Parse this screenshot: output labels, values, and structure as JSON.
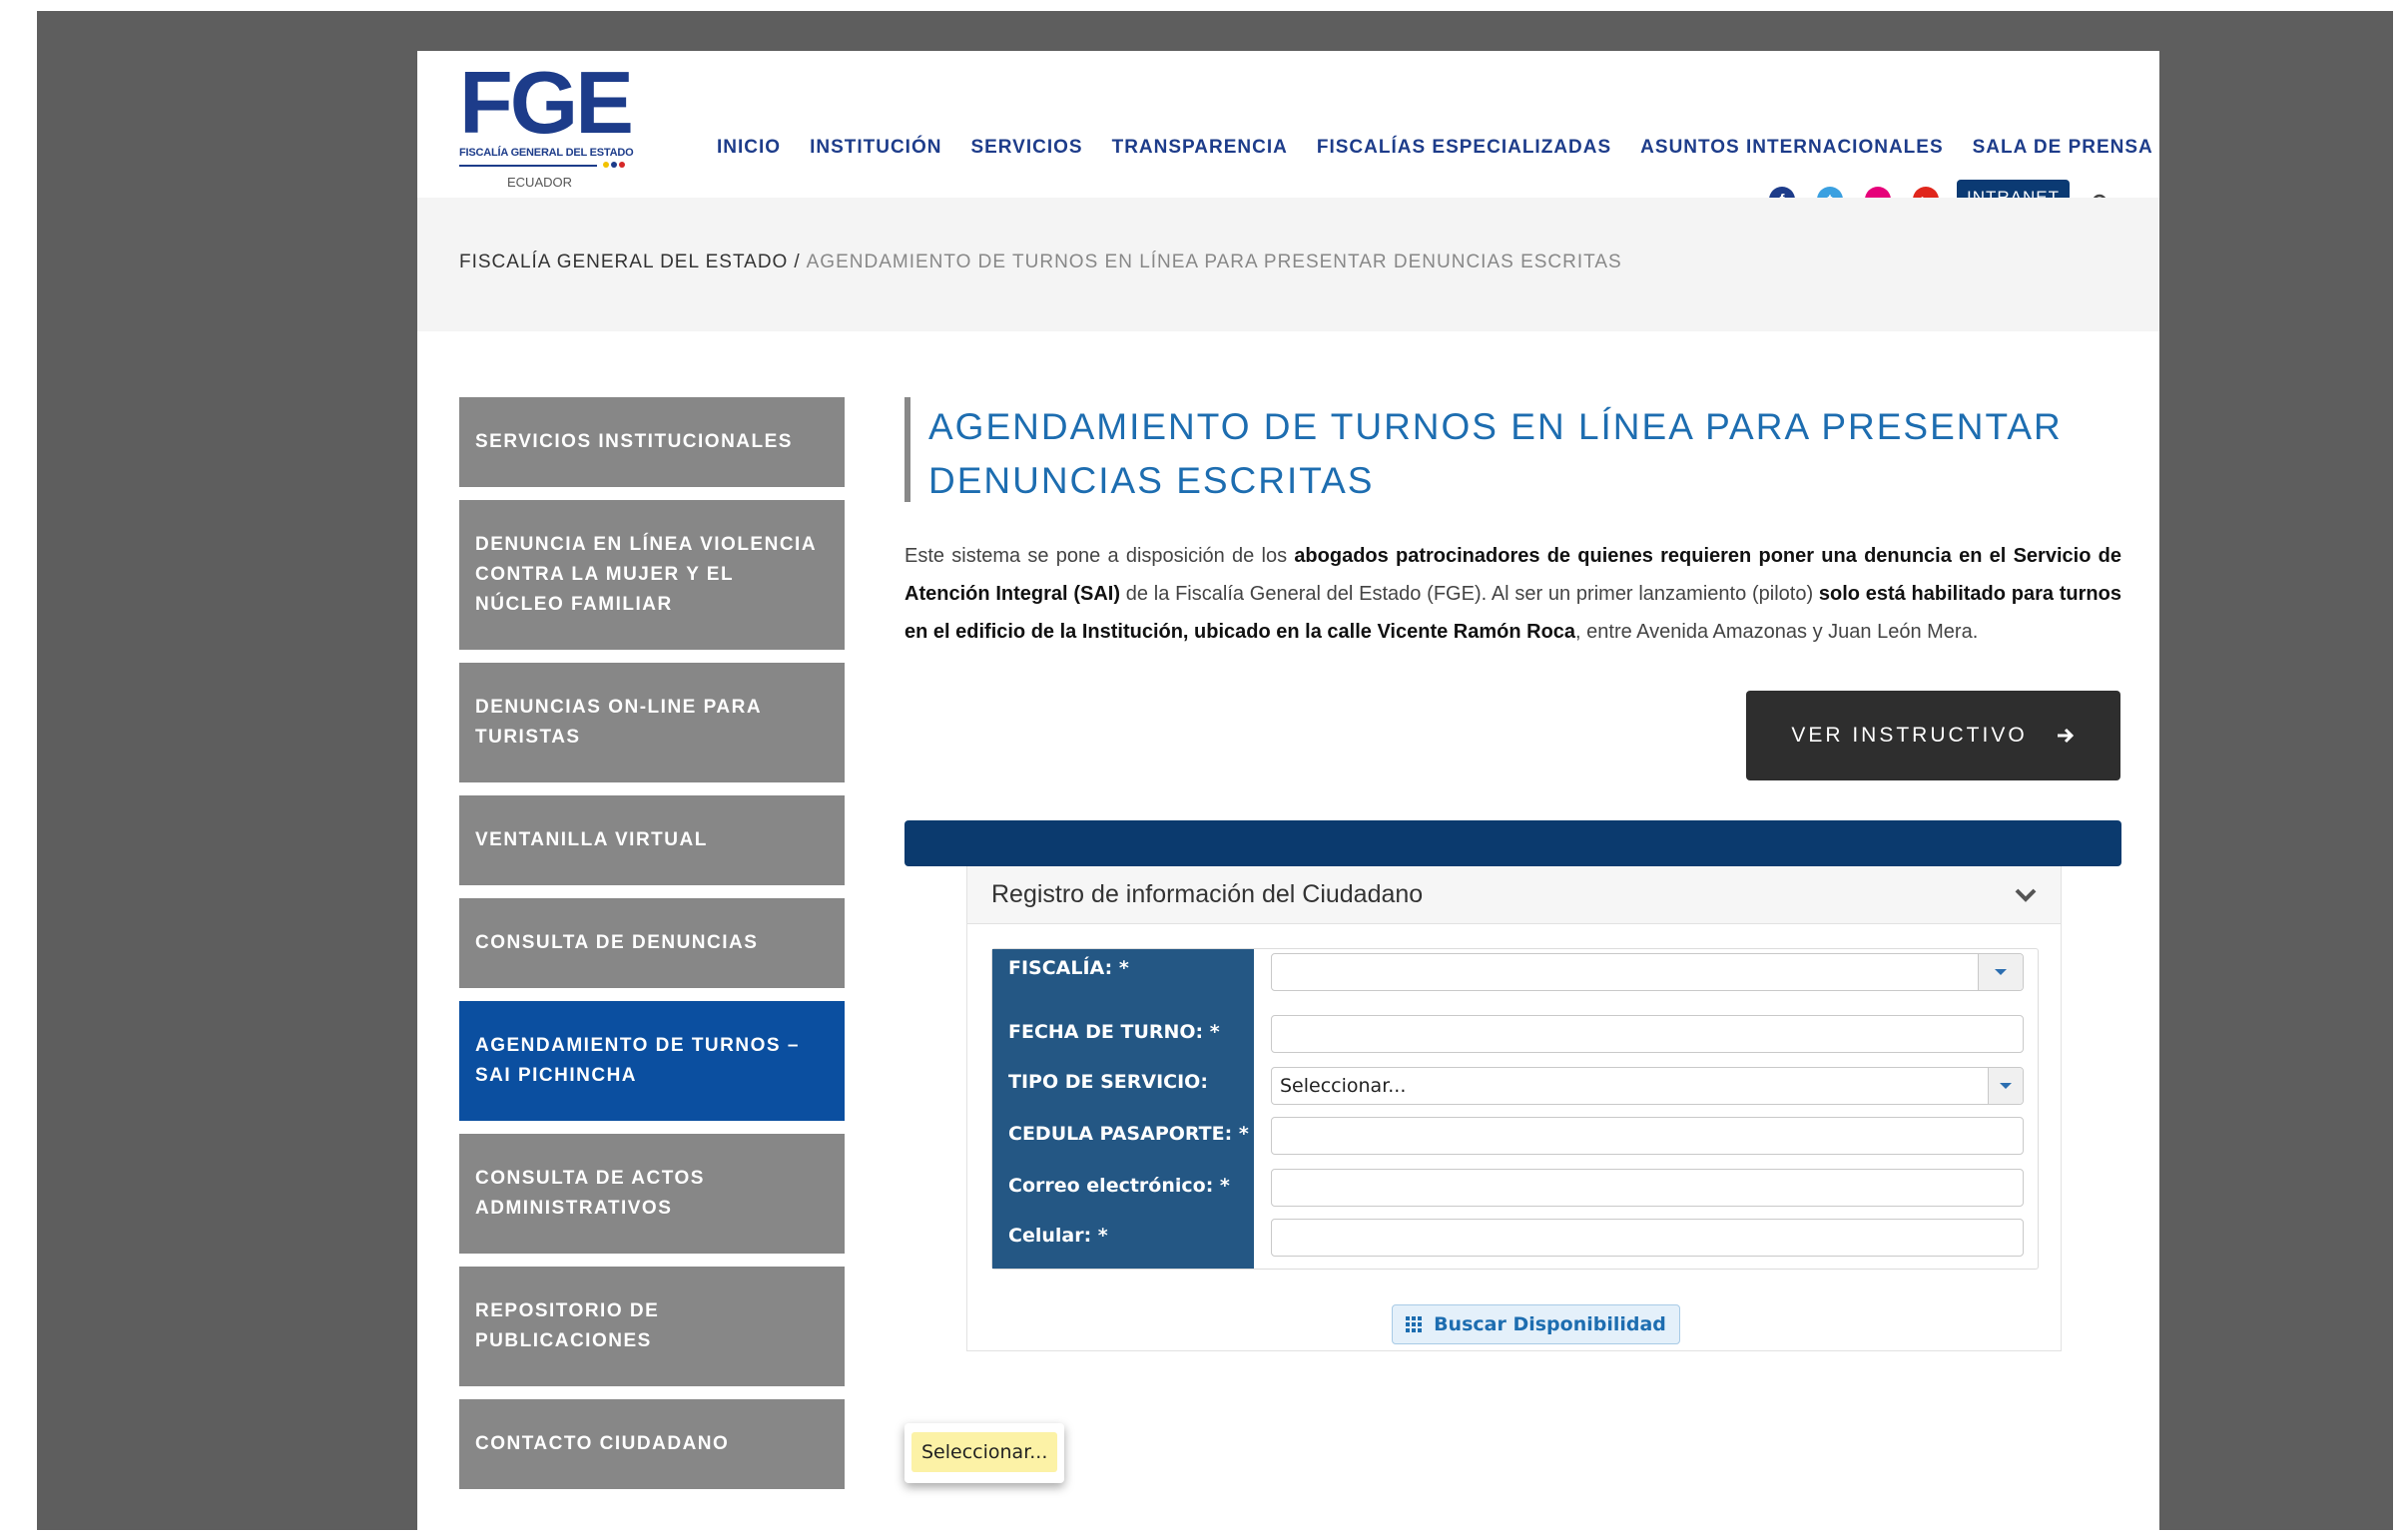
{
  "logo": {
    "text": "FGE",
    "subtitle": "FISCALÍA GENERAL DEL ESTADO",
    "country": "ECUADOR"
  },
  "nav": [
    "INICIO",
    "INSTITUCIÓN",
    "SERVICIOS",
    "TRANSPARENCIA",
    "FISCALÍAS ESPECIALIZADAS",
    "ASUNTOS INTERNACIONALES",
    "SALA DE PRENSA"
  ],
  "social": [
    {
      "icon": "facebook-icon",
      "glyph": "f",
      "color": "#1d3c8a"
    },
    {
      "icon": "twitter-icon",
      "glyph": "t",
      "color": "#3ba0e0"
    },
    {
      "icon": "flickr-icon",
      "glyph": "••",
      "color": "#e6007a"
    },
    {
      "icon": "youtube-icon",
      "glyph": "▶",
      "color": "#e0261c"
    }
  ],
  "intranet_label": "INTRANET",
  "breadcrumb": {
    "root": "FISCALÍA GENERAL DEL ESTADO",
    "separator": "/",
    "current": "AGENDAMIENTO DE TURNOS EN LÍNEA PARA PRESENTAR DENUNCIAS ESCRITAS"
  },
  "sidebar": [
    {
      "label": "SERVICIOS INSTITUCIONALES",
      "active": false
    },
    {
      "label": "DENUNCIA EN LÍNEA VIOLENCIA CONTRA LA MUJER Y EL NÚCLEO FAMILIAR",
      "active": false
    },
    {
      "label": "DENUNCIAS ON-LINE PARA TURISTAS",
      "active": false
    },
    {
      "label": "VENTANILLA VIRTUAL",
      "active": false
    },
    {
      "label": "CONSULTA DE DENUNCIAS",
      "active": false
    },
    {
      "label": "AGENDAMIENTO DE TURNOS – SAI PICHINCHA",
      "active": true
    },
    {
      "label": "CONSULTA DE ACTOS ADMINISTRATIVOS",
      "active": false
    },
    {
      "label": "REPOSITORIO DE PUBLICACIONES",
      "active": false
    },
    {
      "label": "CONTACTO CIUDADANO",
      "active": false
    }
  ],
  "main": {
    "title": "AGENDAMIENTO DE TURNOS EN LÍNEA PARA PRESENTAR DENUNCIAS ESCRITAS",
    "intro": [
      {
        "t": "Este sistema se pone a disposición de los ",
        "b": false
      },
      {
        "t": "abogados patrocinadores de quienes requieren poner una denuncia en el Servicio de Atención Integral (SAI)",
        "b": true
      },
      {
        "t": " de la Fiscalía General del Estado (FGE). Al ser un primer lanzamiento (piloto) ",
        "b": false
      },
      {
        "t": "solo está habilitado para turnos en el edificio de la Institución, ubicado en la calle Vicente Ramón Roca",
        "b": true
      },
      {
        "t": ", entre Avenida Amazonas y Juan León Mera.",
        "b": false
      }
    ],
    "instructivo_button": "VER INSTRUCTIVO"
  },
  "form": {
    "panel_title": "Registro de información del Ciudadano",
    "fields": [
      {
        "name": "fiscalia",
        "label": "FISCALÍA: *",
        "value": "",
        "dropdown": true
      },
      {
        "name": "fecha-de-turno",
        "label": "FECHA DE TURNO: *",
        "value": "",
        "dropdown": false
      },
      {
        "name": "tipo-de-servicio",
        "label": "TIPO DE SERVICIO:",
        "value": "Seleccionar...",
        "dropdown": true
      },
      {
        "name": "cedula-pasaporte",
        "label": "CEDULA PASAPORTE: *",
        "value": "",
        "dropdown": false
      },
      {
        "name": "correo-electronico",
        "label": "Correo electrónico: *",
        "value": "",
        "dropdown": false
      },
      {
        "name": "celular",
        "label": "Celular: *",
        "value": "",
        "dropdown": false
      }
    ],
    "search_button": "Buscar Disponibilidad"
  },
  "tooltip": "Seleccionar...",
  "colors": {
    "brand_blue": "#1d3c8a",
    "title_blue": "#1d6db0",
    "active_side": "#0b4fa0",
    "form_label_bg": "#245784",
    "side_bg": "#878787"
  }
}
